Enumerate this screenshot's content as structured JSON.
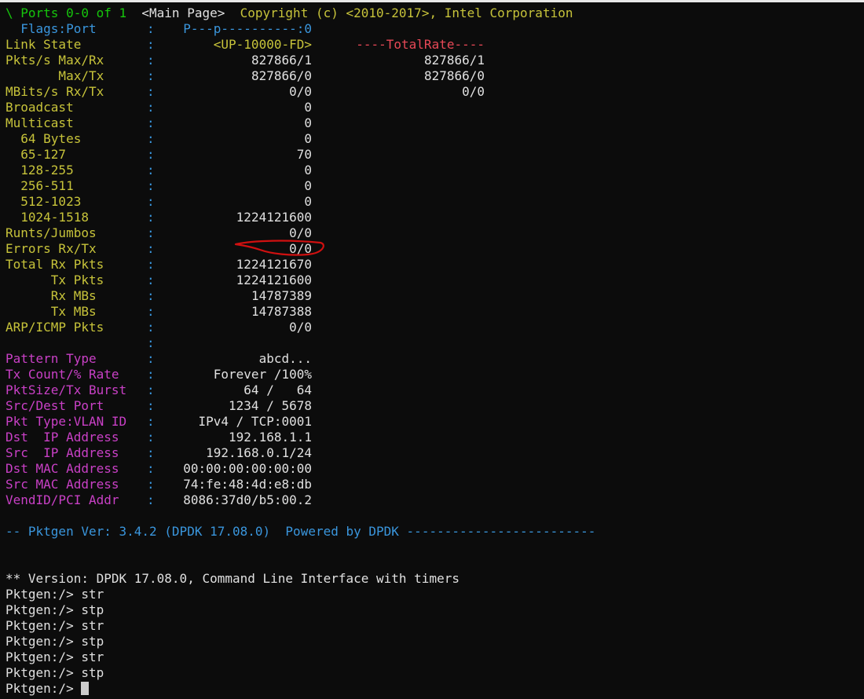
{
  "colors": {
    "background": "#0c0c0c",
    "green": "#16c60c",
    "white": "#e0e0e0",
    "yellow": "#c7c33a",
    "cyan": "#3a96dd",
    "red": "#e74856",
    "magenta": "#c940c6",
    "annotation": "#d01010"
  },
  "header": {
    "ports": "\\ Ports 0-0 of 1",
    "page": "<Main Page>",
    "copyright": "Copyright (c) <2010-2017>, Intel Corporation"
  },
  "flags": {
    "label": "  Flags:Port",
    "sep": ":",
    "value": "P---p----------:0"
  },
  "link": {
    "label": "Link State",
    "sep": ":",
    "value": "<UP-10000-FD>",
    "total_header": "----TotalRate----"
  },
  "stats": [
    {
      "label": "Pkts/s Max/Rx",
      "value": "827866/1",
      "total": "827866/1"
    },
    {
      "label": "       Max/Tx",
      "value": "827866/0",
      "total": "827866/0"
    },
    {
      "label": "MBits/s Rx/Tx",
      "value": "0/0",
      "total": "0/0"
    },
    {
      "label": "Broadcast",
      "value": "0"
    },
    {
      "label": "Multicast",
      "value": "0"
    },
    {
      "label": "  64 Bytes",
      "value": "0"
    },
    {
      "label": "  65-127",
      "value": "70"
    },
    {
      "label": "  128-255",
      "value": "0"
    },
    {
      "label": "  256-511",
      "value": "0"
    },
    {
      "label": "  512-1023",
      "value": "0"
    },
    {
      "label": "  1024-1518",
      "value": "1224121600"
    },
    {
      "label": "Runts/Jumbos",
      "value": "0/0"
    },
    {
      "label": "Errors Rx/Tx",
      "value": "0/0"
    },
    {
      "label": "Total Rx Pkts",
      "value": "1224121670"
    },
    {
      "label": "      Tx Pkts",
      "value": "1224121600"
    },
    {
      "label": "      Rx MBs",
      "value": "14787389"
    },
    {
      "label": "      Tx MBs",
      "value": "14787388"
    },
    {
      "label": "ARP/ICMP Pkts",
      "value": "0/0"
    }
  ],
  "sep_char": ":",
  "config": [
    {
      "label": "Pattern Type",
      "value": "abcd..."
    },
    {
      "label": "Tx Count/% Rate",
      "value": "Forever /100%"
    },
    {
      "label": "PktSize/Tx Burst",
      "value": "64 /   64"
    },
    {
      "label": "Src/Dest Port",
      "value": "1234 / 5678"
    },
    {
      "label": "Pkt Type:VLAN ID",
      "value": "IPv4 / TCP:0001"
    },
    {
      "label": "Dst  IP Address",
      "value": "192.168.1.1"
    },
    {
      "label": "Src  IP Address",
      "value": "192.168.0.1/24"
    },
    {
      "label": "Dst MAC Address",
      "value": "00:00:00:00:00:00"
    },
    {
      "label": "Src MAC Address",
      "value": "74:fe:48:4d:e8:db"
    },
    {
      "label": "VendID/PCI Addr",
      "value": "8086:37d0/b5:00.2"
    }
  ],
  "footer": {
    "version": "-- Pktgen Ver: 3.4.2 (DPDK 17.08.0)",
    "powered": "Powered by DPDK -------------------------"
  },
  "console": {
    "version_line": "** Version: DPDK 17.08.0, Command Line Interface with timers",
    "history": [
      "Pktgen:/> str",
      "Pktgen:/> stp",
      "Pktgen:/> str",
      "Pktgen:/> stp",
      "Pktgen:/> str",
      "Pktgen:/> stp"
    ],
    "prompt": "Pktgen:/> "
  }
}
